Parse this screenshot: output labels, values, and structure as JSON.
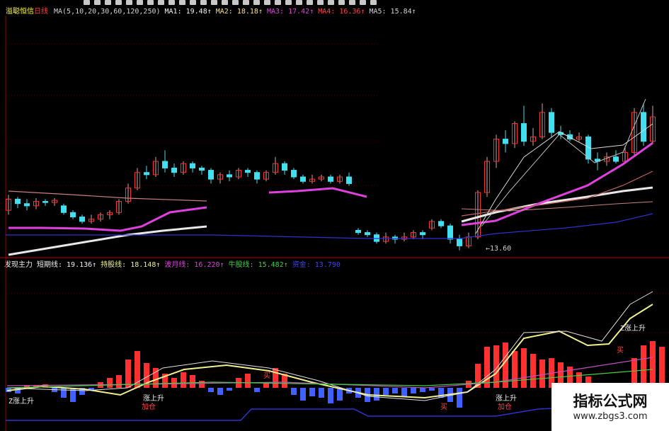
{
  "upper_legend": {
    "name": "溢聪恒信",
    "period": "日线",
    "ma_params": "MA(5,10,20,30,60,120,250)",
    "items": [
      {
        "label": "MA1: 19.48↑",
        "color": "#f0f0f0"
      },
      {
        "label": "MA2: 18.18↑",
        "color": "#f2e08a"
      },
      {
        "label": "MA3: 17.42↑",
        "color": "#e040e0"
      },
      {
        "label": "MA4: 16.36↑",
        "color": "#ff4040"
      },
      {
        "label": "MA5: 15.84↑",
        "color": "#d0d0d0"
      }
    ]
  },
  "lower_legend": {
    "title": "发现主力",
    "items": [
      {
        "label": "短期线: 19.136↑",
        "color": "#f0f0f0"
      },
      {
        "label": "持股线: 18.148↑",
        "color": "#f0f090"
      },
      {
        "label": "波月线: 16.220↑",
        "color": "#e040e0"
      },
      {
        "label": "牛股线: 15.482↑",
        "color": "#40d040"
      },
      {
        "label": "资金: 13.790",
        "color": "#4040ff"
      }
    ]
  },
  "price_annotation": "13.60",
  "signals": [
    {
      "text": "Z涨上升",
      "color": "#f0f0f0"
    },
    {
      "text": "涨上升",
      "color": "#f0f0f0"
    },
    {
      "text": "加仓",
      "color": "#ff4040"
    },
    {
      "text": "买",
      "color": "#ff4040"
    },
    {
      "text": "买",
      "color": "#ff4040"
    },
    {
      "text": "涨上升",
      "color": "#f0f0f0"
    },
    {
      "text": "加仓",
      "color": "#ff4040"
    },
    {
      "text": "Z涨上升",
      "color": "#f0f0f0"
    },
    {
      "text": "买",
      "color": "#ff4040"
    }
  ],
  "watermark": {
    "title": "指标公式网",
    "url": "www.zbgs3.com"
  },
  "colors": {
    "up": "#ff3030",
    "down": "#40e0f0",
    "grid": "#8b0000",
    "bg": "#000000"
  },
  "chart_data": {
    "type": "candlestick",
    "title": "溢聪恒信 日线",
    "panels": [
      "price with MA(5,10,20,30,60,120,250)",
      "发现主力 indicator"
    ],
    "last_values": {
      "MA1": 19.48,
      "MA2": 18.18,
      "MA3": 17.42,
      "MA4": 16.36,
      "MA5": 15.84
    },
    "indicator_last_values": {
      "短期线": 19.136,
      "持股线": 18.148,
      "波月线": 16.22,
      "牛股线": 15.482,
      "资金": 13.79
    },
    "low_marker": 13.6,
    "candles": [
      {
        "o": 15.4,
        "c": 15.9,
        "h": 16.1,
        "l": 15.2
      },
      {
        "o": 15.9,
        "c": 15.7,
        "h": 16.0,
        "l": 15.5
      },
      {
        "o": 15.7,
        "c": 15.6,
        "h": 15.9,
        "l": 15.4
      },
      {
        "o": 15.6,
        "c": 15.8,
        "h": 15.95,
        "l": 15.45
      },
      {
        "o": 15.8,
        "c": 15.75,
        "h": 15.9,
        "l": 15.6
      },
      {
        "o": 15.75,
        "c": 15.85,
        "h": 15.95,
        "l": 15.6
      },
      {
        "o": 15.6,
        "c": 15.3,
        "h": 15.7,
        "l": 15.2
      },
      {
        "o": 15.3,
        "c": 15.1,
        "h": 15.4,
        "l": 15.0
      },
      {
        "o": 15.1,
        "c": 14.9,
        "h": 15.2,
        "l": 14.8
      },
      {
        "o": 14.9,
        "c": 15.0,
        "h": 15.2,
        "l": 14.8
      },
      {
        "o": 15.0,
        "c": 15.2,
        "h": 15.3,
        "l": 14.9
      },
      {
        "o": 15.2,
        "c": 15.3,
        "h": 15.4,
        "l": 15.0
      },
      {
        "o": 15.3,
        "c": 15.8,
        "h": 15.9,
        "l": 15.2
      },
      {
        "o": 15.8,
        "c": 16.4,
        "h": 16.6,
        "l": 15.7
      },
      {
        "o": 16.4,
        "c": 17.1,
        "h": 17.3,
        "l": 16.3
      },
      {
        "o": 17.1,
        "c": 17.0,
        "h": 17.4,
        "l": 16.8
      },
      {
        "o": 17.0,
        "c": 17.6,
        "h": 17.8,
        "l": 16.9
      },
      {
        "o": 17.6,
        "c": 17.3,
        "h": 18.1,
        "l": 17.1
      },
      {
        "o": 17.3,
        "c": 17.1,
        "h": 17.5,
        "l": 16.9
      },
      {
        "o": 17.1,
        "c": 17.5,
        "h": 17.6,
        "l": 17.0
      },
      {
        "o": 17.5,
        "c": 17.3,
        "h": 17.6,
        "l": 17.1
      },
      {
        "o": 17.3,
        "c": 17.2,
        "h": 17.4,
        "l": 17.0
      },
      {
        "o": 17.2,
        "c": 16.8,
        "h": 17.3,
        "l": 16.6
      },
      {
        "o": 16.8,
        "c": 17.0,
        "h": 17.1,
        "l": 16.6
      },
      {
        "o": 17.0,
        "c": 16.9,
        "h": 17.2,
        "l": 16.7
      },
      {
        "o": 16.9,
        "c": 17.2,
        "h": 17.3,
        "l": 16.8
      },
      {
        "o": 17.2,
        "c": 17.1,
        "h": 17.3,
        "l": 16.9
      },
      {
        "o": 17.1,
        "c": 16.8,
        "h": 17.2,
        "l": 16.6
      },
      {
        "o": 16.8,
        "c": 17.1,
        "h": 17.2,
        "l": 16.7
      },
      {
        "o": 17.1,
        "c": 17.5,
        "h": 17.8,
        "l": 17.0
      },
      {
        "o": 17.5,
        "c": 17.2,
        "h": 17.6,
        "l": 17.0
      },
      {
        "o": 17.2,
        "c": 16.9,
        "h": 17.3,
        "l": 16.8
      },
      {
        "o": 16.9,
        "c": 16.7,
        "h": 17.0,
        "l": 16.6
      },
      {
        "o": 16.7,
        "c": 16.8,
        "h": 17.0,
        "l": 16.6
      },
      {
        "o": 16.8,
        "c": 16.9,
        "h": 17.0,
        "l": 16.7
      },
      {
        "o": 16.9,
        "c": 16.7,
        "h": 17.0,
        "l": 16.6
      },
      {
        "o": 16.7,
        "c": 16.9,
        "h": 17.0,
        "l": 16.6
      },
      {
        "o": 16.9,
        "c": 16.6,
        "h": 17.1,
        "l": 16.5
      },
      {
        "o": 14.5,
        "c": 14.4,
        "h": 14.6,
        "l": 14.3
      },
      {
        "o": 14.4,
        "c": 14.3,
        "h": 14.5,
        "l": 14.2
      },
      {
        "o": 14.3,
        "c": 14.0,
        "h": 14.4,
        "l": 13.9
      },
      {
        "o": 14.0,
        "c": 14.2,
        "h": 14.4,
        "l": 13.9
      },
      {
        "o": 14.2,
        "c": 14.1,
        "h": 14.3,
        "l": 13.9
      },
      {
        "o": 14.1,
        "c": 14.2,
        "h": 14.4,
        "l": 14.0
      },
      {
        "o": 14.2,
        "c": 14.4,
        "h": 14.5,
        "l": 14.1
      },
      {
        "o": 14.4,
        "c": 14.3,
        "h": 14.5,
        "l": 14.1
      },
      {
        "o": 14.6,
        "c": 14.9,
        "h": 15.0,
        "l": 14.5
      },
      {
        "o": 14.9,
        "c": 14.7,
        "h": 15.0,
        "l": 14.6
      },
      {
        "o": 14.7,
        "c": 14.1,
        "h": 14.8,
        "l": 13.9
      },
      {
        "o": 14.1,
        "c": 13.8,
        "h": 14.3,
        "l": 13.6
      },
      {
        "o": 13.8,
        "c": 14.2,
        "h": 14.4,
        "l": 13.7
      },
      {
        "o": 14.2,
        "c": 16.2,
        "h": 16.3,
        "l": 14.1
      },
      {
        "o": 16.2,
        "c": 17.6,
        "h": 17.8,
        "l": 16.0
      },
      {
        "o": 17.6,
        "c": 18.6,
        "h": 18.8,
        "l": 17.3
      },
      {
        "o": 18.6,
        "c": 18.4,
        "h": 19.0,
        "l": 18.0
      },
      {
        "o": 18.4,
        "c": 19.3,
        "h": 19.4,
        "l": 18.2
      },
      {
        "o": 19.3,
        "c": 18.5,
        "h": 20.1,
        "l": 18.3
      },
      {
        "o": 18.5,
        "c": 18.7,
        "h": 19.1,
        "l": 18.3
      },
      {
        "o": 18.7,
        "c": 19.8,
        "h": 20.2,
        "l": 18.6
      },
      {
        "o": 19.8,
        "c": 18.9,
        "h": 20.0,
        "l": 18.7
      },
      {
        "o": 18.9,
        "c": 18.8,
        "h": 19.2,
        "l": 18.6
      },
      {
        "o": 18.8,
        "c": 18.6,
        "h": 19.0,
        "l": 18.5
      },
      {
        "o": 18.6,
        "c": 18.7,
        "h": 18.9,
        "l": 18.5
      },
      {
        "o": 18.7,
        "c": 17.7,
        "h": 18.8,
        "l": 17.5
      },
      {
        "o": 17.7,
        "c": 17.6,
        "h": 18.0,
        "l": 17.2
      },
      {
        "o": 17.6,
        "c": 17.8,
        "h": 18.0,
        "l": 17.4
      },
      {
        "o": 17.8,
        "c": 17.6,
        "h": 18.1,
        "l": 17.5
      },
      {
        "o": 17.6,
        "c": 18.0,
        "h": 18.3,
        "l": 17.5
      },
      {
        "o": 18.0,
        "c": 19.8,
        "h": 20.0,
        "l": 17.9
      },
      {
        "o": 19.8,
        "c": 18.5,
        "h": 20.2,
        "l": 18.3
      },
      {
        "o": 18.5,
        "c": 19.6,
        "h": 20.1,
        "l": 18.4
      }
    ]
  }
}
